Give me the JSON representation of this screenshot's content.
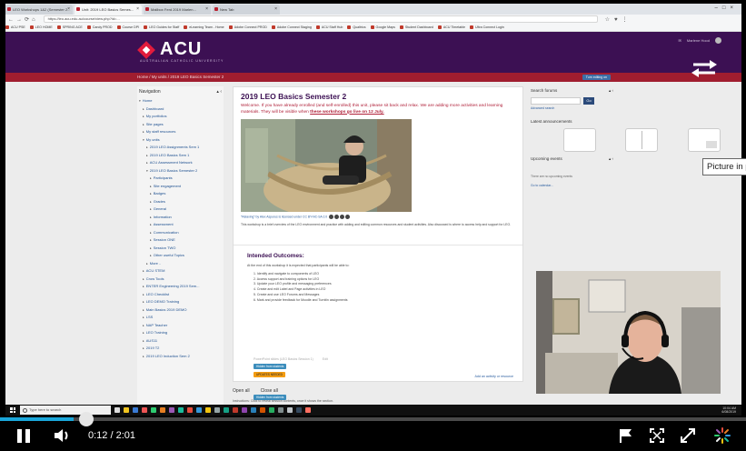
{
  "browser": {
    "tabs": [
      {
        "label": "LEO Workshops 1&2 (Semester 2..."
      },
      {
        "label": "Unit: 2019 LEO Basics Semes..."
      },
      {
        "label": "Mailbox Ferd 2019 Marlen..."
      },
      {
        "label": "New Tab"
      }
    ],
    "url": "https://leo.acu.edu.au/course/view.php?id=...",
    "bookmarks": [
      "ACU PSE",
      "LEO HOME",
      "SPRING ACE",
      "Candy PROD",
      "Course DPI",
      "LEO Guides for Staff",
      "eLearning Team - Home",
      "Adobe Connect PROD",
      "Adobe Connect Staging",
      "ACU Staff Hub",
      "Qualtrics",
      "Google Maps",
      "Student Dashboard",
      "ACU Timetable",
      "Ultra Connect Login"
    ]
  },
  "site": {
    "logo_text": "ACU",
    "logo_sub": "AUSTRALIAN CATHOLIC UNIVERSITY",
    "user_name": "Marlene Hood",
    "breadcrumb": "Home  /  My units  /  2019 LEO Basics Semester 2",
    "edit_button": "Turn editing on"
  },
  "navigation": {
    "title": "Navigation",
    "items": [
      {
        "label": "Home",
        "level": 0,
        "open": true
      },
      {
        "label": "Dashboard",
        "level": 1
      },
      {
        "label": "My portfolios",
        "level": 1
      },
      {
        "label": "Site pages",
        "level": 1
      },
      {
        "label": "My staff resources",
        "level": 1
      },
      {
        "label": "My units",
        "level": 1,
        "open": true
      },
      {
        "label": "2019 LEO Assignments Sem 1",
        "level": 2
      },
      {
        "label": "2019 LEO Basics Sem 1",
        "level": 2
      },
      {
        "label": "ACU Assessment Network",
        "level": 2
      },
      {
        "label": "2019 LEO Basics Semester 2",
        "level": 2,
        "open": true
      },
      {
        "label": "Participants",
        "level": 3
      },
      {
        "label": "Site engagement",
        "level": 3
      },
      {
        "label": "Badges",
        "level": 3
      },
      {
        "label": "Grades",
        "level": 3
      },
      {
        "label": "General",
        "level": 3
      },
      {
        "label": "Information",
        "level": 3
      },
      {
        "label": "Assessment",
        "level": 3
      },
      {
        "label": "Communication",
        "level": 3
      },
      {
        "label": "Session ONE",
        "level": 3
      },
      {
        "label": "Session TWO",
        "level": 3
      },
      {
        "label": "Other useful Topics",
        "level": 3
      },
      {
        "label": "More ..",
        "level": 2
      },
      {
        "label": "ACU STEM",
        "level": 1
      },
      {
        "label": "Crow Tools",
        "level": 1
      },
      {
        "label": "ENTER Engineering 2019 Sem...",
        "level": 1
      },
      {
        "label": "LEO Checklist",
        "level": 1
      },
      {
        "label": "LEO DEMO Training",
        "level": 1
      },
      {
        "label": "Main Basics 2019 DEMO",
        "level": 1
      },
      {
        "label": "LSS",
        "level": 1
      },
      {
        "label": "NAP Teacher",
        "level": 1
      },
      {
        "label": "LEO Training",
        "level": 1
      },
      {
        "label": "AUS11",
        "level": 1
      },
      {
        "label": "2019 T2",
        "level": 1
      },
      {
        "label": "2019 LEO Induction Sem 2",
        "level": 1
      }
    ]
  },
  "course": {
    "title": "2019 LEO Basics Semester 2",
    "welcome_text": "Welcome. If you have already enrolled (and self-enrolled) this unit, please sit back and relax. We are adding more activities and learning materials. They will be visible when ",
    "welcome_link": "these workshops go live on 12 July.",
    "caption": "\"Relaxing\" by Alex Aspurus is licensed under CC BY-NC-SA 2.0",
    "description": "This workshop is a brief overview of the LEO environment and practice with adding and editing common resources and student activities. Also discussed is where to access help and support for LEO.",
    "outcomes_title": "Intended Outcomes:",
    "outcomes_lead": "At the end of this workshop it is expected that participants will be able to:",
    "outcomes": [
      "1. Identify and navigate to components of LEO",
      "2. Access support and training options for LEO",
      "3. Update your LEO profile and messaging preferences",
      "4. Create and edit Label and Page activities in LEO",
      "5. Create and use LEO Forums and Messages",
      "6. Mark and provide feedback for Moodle and Turnitin assignments"
    ],
    "resource_label": "PowerPoint slides (LEO Basics Session 1)",
    "badge_hidden_1": "Hidden from students",
    "badge_updates": "UPDATES NEEDED",
    "badge_hidden_2": "Hidden from students",
    "edit_label": "Edit",
    "add_link": "Add an activity or resource",
    "open_all": "Open all",
    "close_all": "Close all",
    "footer_note": "Instructions: Click to reveal session contents, once it shows the section."
  },
  "right": {
    "search_title": "Search forums",
    "go": "Go",
    "advanced": "Advanced search",
    "announcements_title": "Latest announcements",
    "events_title": "Upcoming events",
    "no_events": "There are no upcoming events",
    "goto_calendar": "Go to calendar..."
  },
  "tooltip": "Picture in picture",
  "taskbar": {
    "search_placeholder": "Type here to search",
    "time": "10:04 AM",
    "date": "6/08/2019"
  },
  "player": {
    "current_time": "0:12",
    "duration": "/ 2:01",
    "progress": 0.099,
    "accent": "#1aa6d9"
  }
}
